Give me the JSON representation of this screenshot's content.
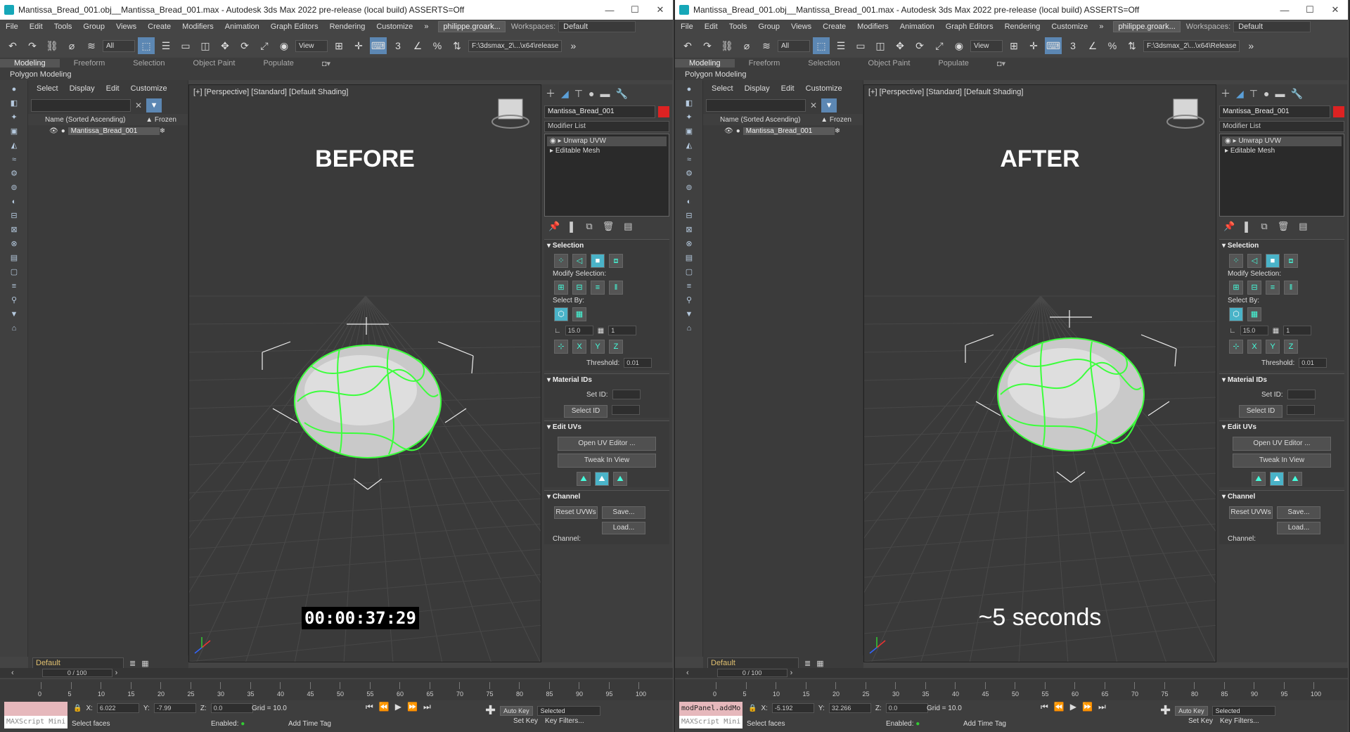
{
  "panels": [
    {
      "title": "Mantissa_Bread_001.obj__Mantissa_Bread_001.max - Autodesk 3ds Max 2022 pre-release (local build) ASSERTS=Off",
      "menu": [
        "File",
        "Edit",
        "Tools",
        "Group",
        "Views",
        "Create",
        "Modifiers",
        "Animation",
        "Graph Editors",
        "Rendering",
        "Customize"
      ],
      "account": "philippe.groark...",
      "workspace_label": "Workspaces:",
      "workspace_value": "Default",
      "sel_filter": "All",
      "view_dd": "View",
      "path": "F:\\3dsmax_2\\...\\x64\\release",
      "ribbon_tabs": [
        "Modeling",
        "Freeform",
        "Selection",
        "Object Paint",
        "Populate"
      ],
      "subribbon": "Polygon Modeling",
      "scene_tabs": [
        "Select",
        "Display",
        "Edit",
        "Customize"
      ],
      "scene_header": "Name (Sorted Ascending)",
      "frozen_header": "▲ Frozen",
      "scene_item": "Mantissa_Bread_001",
      "layer": "Default",
      "viewport_label": "[+] [Perspective] [Standard] [Default Shading]",
      "overlay": "BEFORE",
      "caption": "00:00:37:29",
      "object_name": "Mantissa_Bread_001",
      "modifier_list": "Modifier List",
      "stack": [
        "Unwrap UVW",
        "Editable Mesh"
      ],
      "sel_title": "Selection",
      "modify_selection": "Modify Selection:",
      "select_by": "Select By:",
      "angle_value": "15.0",
      "count_value": "1",
      "threshold_label": "Threshold:",
      "threshold_value": "0.01",
      "mat_title": "Material IDs",
      "set_id": "Set ID:",
      "select_id": "Select ID",
      "edit_uvs_title": "Edit UVs",
      "open_uv": "Open UV Editor ...",
      "tweak": "Tweak In View",
      "channel_title": "Channel",
      "reset_uvws": "Reset UVWs",
      "save": "Save...",
      "load": "Load...",
      "channel_label": "Channel:",
      "frame_counter": "0 / 100",
      "ticks": [
        "0",
        "5",
        "10",
        "15",
        "20",
        "25",
        "30",
        "35",
        "40",
        "45",
        "50",
        "55",
        "60",
        "65",
        "70",
        "75",
        "80",
        "85",
        "90",
        "95",
        "100"
      ],
      "maxscript1": "",
      "maxscript2": "MAXScript Mini",
      "status_text": "Select faces",
      "x_label": "X:",
      "x_value": "6.022",
      "y_label": "Y:",
      "y_value": "-7.99",
      "z_label": "Z:",
      "z_value": "0.0",
      "grid": "Grid = 10.0",
      "enabled": "Enabled:",
      "add_time_tag": "Add Time Tag",
      "auto_key": "Auto Key",
      "set_key": "Set Key",
      "selected": "Selected",
      "key_filters": "Key Filters...",
      "frame_spin": "0"
    },
    {
      "title": "Mantissa_Bread_001.obj__Mantissa_Bread_001.max - Autodesk 3ds Max 2022 pre-release (local build) ASSERTS=Off",
      "menu": [
        "File",
        "Edit",
        "Tools",
        "Group",
        "Views",
        "Create",
        "Modifiers",
        "Animation",
        "Graph Editors",
        "Rendering",
        "Customize"
      ],
      "account": "philippe.groark...",
      "workspace_label": "Workspaces:",
      "workspace_value": "Default",
      "sel_filter": "All",
      "view_dd": "View",
      "path": "F:\\3dsmax_2\\...\\x64\\Release",
      "ribbon_tabs": [
        "Modeling",
        "Freeform",
        "Selection",
        "Object Paint",
        "Populate"
      ],
      "subribbon": "Polygon Modeling",
      "scene_tabs": [
        "Select",
        "Display",
        "Edit",
        "Customize"
      ],
      "scene_header": "Name (Sorted Ascending)",
      "frozen_header": "▲ Frozen",
      "scene_item": "Mantissa_Bread_001",
      "layer": "Default",
      "viewport_label": "[+] [Perspective] [Standard] [Default Shading]",
      "overlay": "AFTER",
      "caption": "~5 seconds",
      "object_name": "Mantissa_Bread_001",
      "modifier_list": "Modifier List",
      "stack": [
        "Unwrap UVW",
        "Editable Mesh"
      ],
      "sel_title": "Selection",
      "modify_selection": "Modify Selection:",
      "select_by": "Select By:",
      "angle_value": "15.0",
      "count_value": "1",
      "threshold_label": "Threshold:",
      "threshold_value": "0.01",
      "mat_title": "Material IDs",
      "set_id": "Set ID:",
      "select_id": "Select ID",
      "edit_uvs_title": "Edit UVs",
      "open_uv": "Open UV Editor ...",
      "tweak": "Tweak In View",
      "channel_title": "Channel",
      "reset_uvws": "Reset UVWs",
      "save": "Save...",
      "load": "Load...",
      "channel_label": "Channel:",
      "frame_counter": "0 / 100",
      "ticks": [
        "0",
        "5",
        "10",
        "15",
        "20",
        "25",
        "30",
        "35",
        "40",
        "45",
        "50",
        "55",
        "60",
        "65",
        "70",
        "75",
        "80",
        "85",
        "90",
        "95",
        "100"
      ],
      "maxscript1": "modPanel.addMo",
      "maxscript2": "MAXScript Mini",
      "status_text": "Select faces",
      "x_label": "X:",
      "x_value": "-5.192",
      "y_label": "Y:",
      "y_value": "32.266",
      "z_label": "Z:",
      "z_value": "0.0",
      "grid": "Grid = 10.0",
      "enabled": "Enabled:",
      "add_time_tag": "Add Time Tag",
      "auto_key": "Auto Key",
      "set_key": "Set Key",
      "selected": "Selected",
      "key_filters": "Key Filters...",
      "frame_spin": "0"
    }
  ]
}
